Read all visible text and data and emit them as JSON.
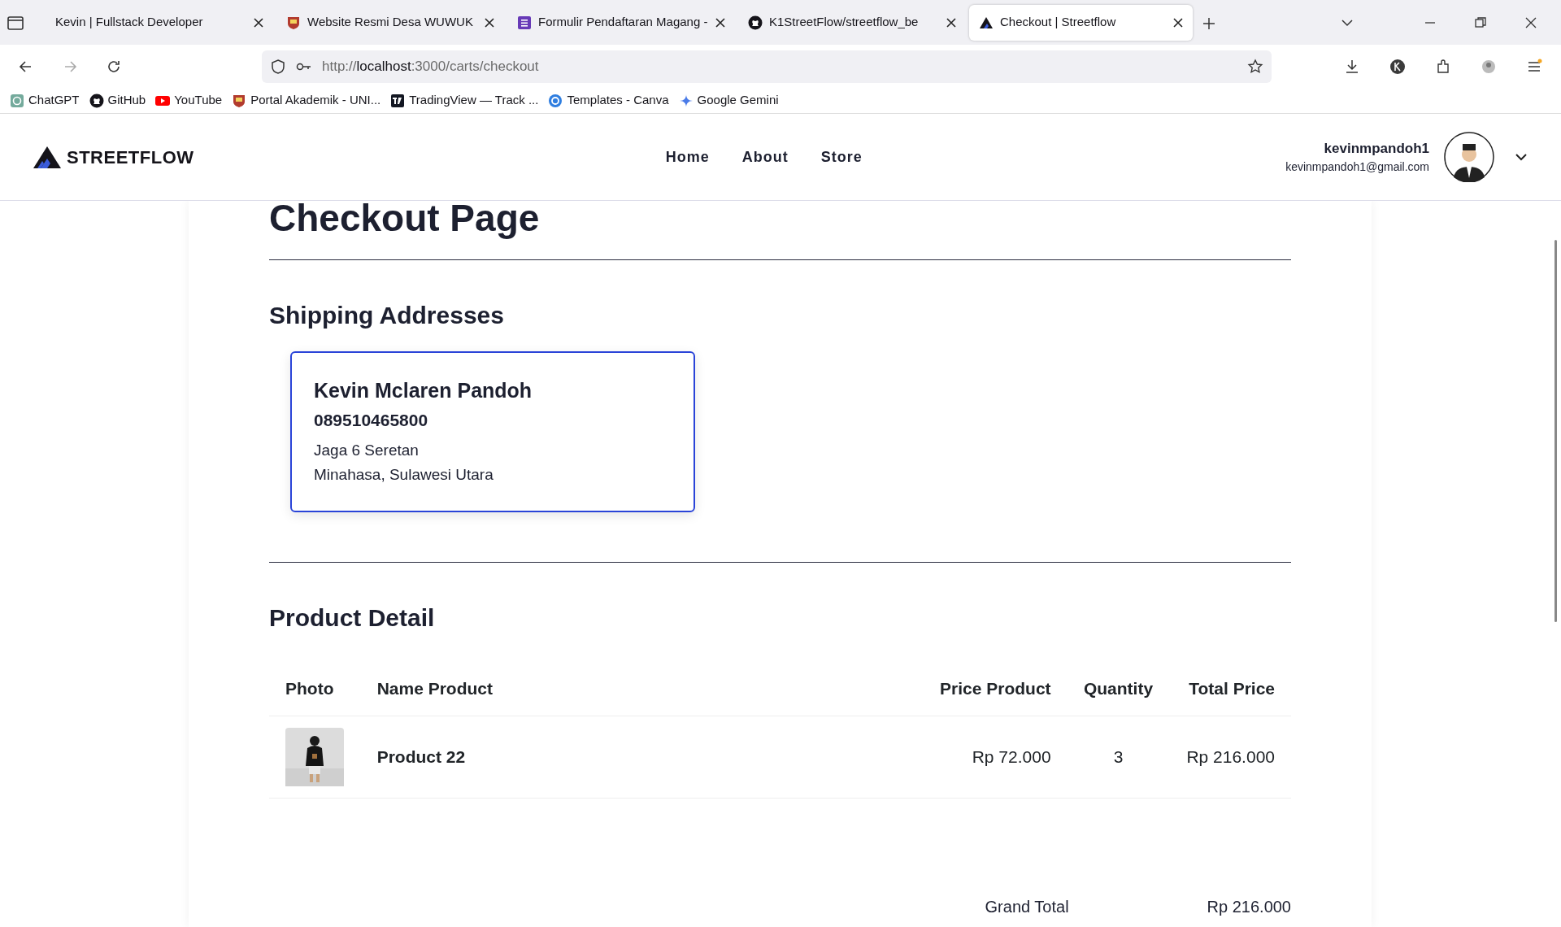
{
  "browser": {
    "tabs": [
      {
        "title": "Kevin | Fullstack Developer",
        "selected": false
      },
      {
        "title": "Website Resmi Desa WUWUK",
        "selected": false
      },
      {
        "title": "Formulir Pendaftaran Magang -",
        "selected": false
      },
      {
        "title": "K1StreetFlow/streetflow_be",
        "selected": false
      },
      {
        "title": "Checkout | Streetflow",
        "selected": true
      }
    ],
    "url": {
      "scheme": "http://",
      "host": "localhost",
      "path": ":3000/carts/checkout"
    },
    "bookmarks": [
      "ChatGPT",
      "GitHub",
      "YouTube",
      "Portal Akademik - UNI...",
      "TradingView — Track ...",
      "Templates - Canva",
      "Google Gemini"
    ]
  },
  "navbar": {
    "brand": "STREETFLOW",
    "links": [
      "Home",
      "About",
      "Store"
    ],
    "user": {
      "name": "kevinmpandoh1",
      "email": "kevinmpandoh1@gmail.com"
    }
  },
  "page": {
    "title": "Checkout Page",
    "shipping": {
      "title": "Shipping Addresses",
      "addresses": [
        {
          "name": "Kevin Mclaren Pandoh",
          "phone": "089510465800",
          "line1": "Jaga 6 Seretan",
          "line2": "Minahasa, Sulawesi Utara",
          "selected": true
        }
      ]
    },
    "products": {
      "title": "Product Detail",
      "columns": [
        "Photo",
        "Name Product",
        "Price Product",
        "Quantity",
        "Total Price"
      ],
      "rows": [
        {
          "name": "Product 22",
          "price": "Rp 72.000",
          "quantity": "3",
          "total": "Rp 216.000"
        }
      ]
    },
    "grand_total": {
      "label": "Grand Total",
      "value": "Rp 216.000"
    }
  }
}
